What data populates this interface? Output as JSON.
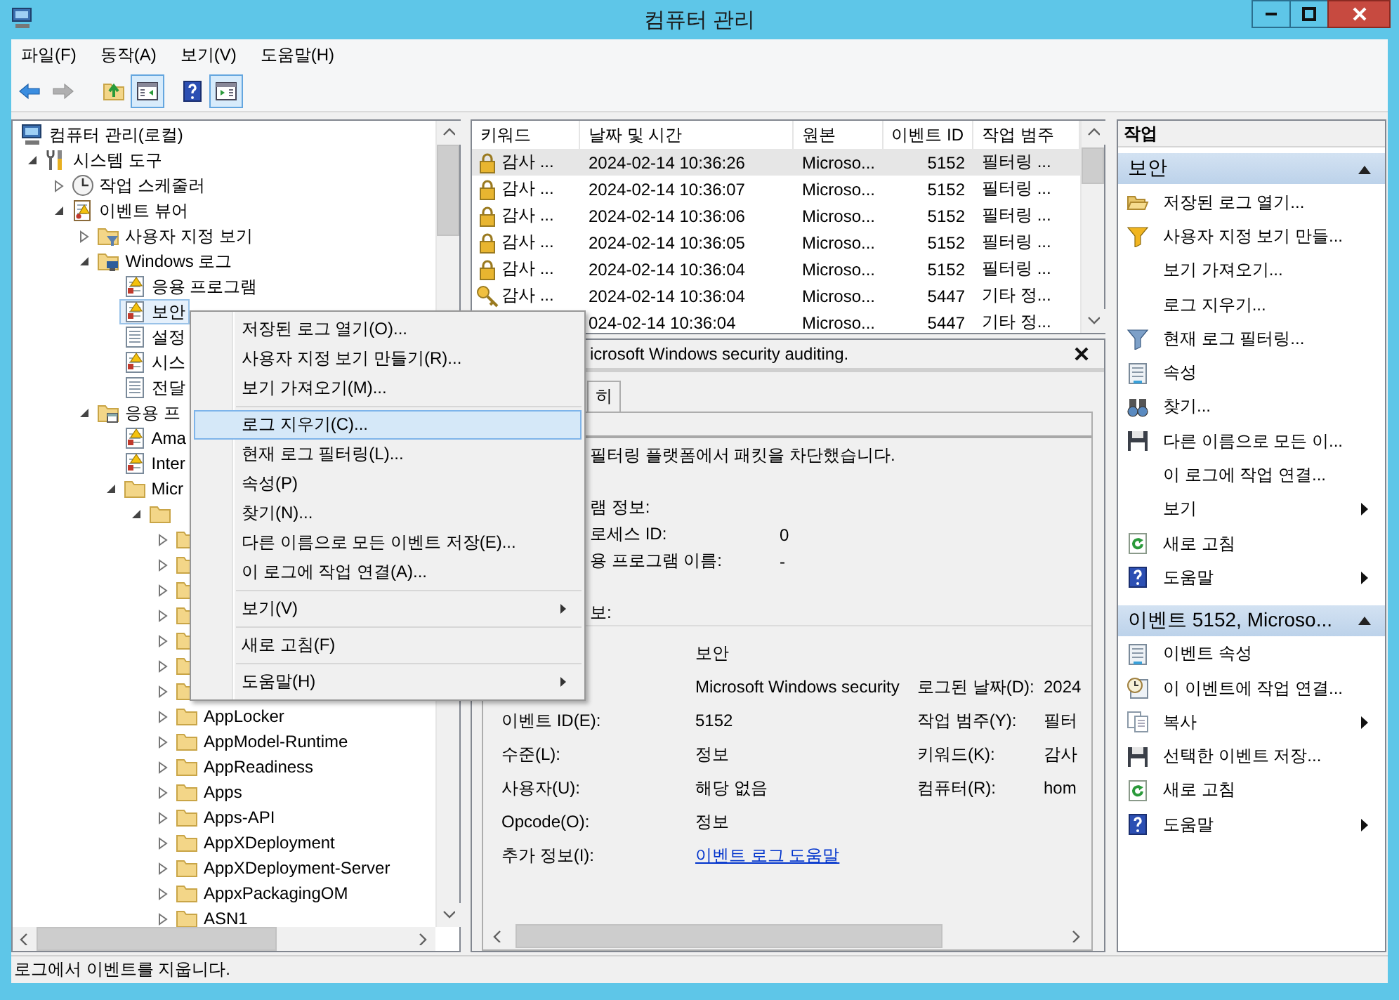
{
  "window": {
    "title": "컴퓨터 관리"
  },
  "menu_bar": [
    {
      "label": "파일(F)"
    },
    {
      "label": "동작(A)"
    },
    {
      "label": "보기(V)"
    },
    {
      "label": "도움말(H)"
    }
  ],
  "toolbar": [
    {
      "kind": "back",
      "pressed": false,
      "disabled": false
    },
    {
      "kind": "forward",
      "pressed": false,
      "disabled": true
    },
    {
      "kind": "up",
      "pressed": false,
      "disabled": false
    },
    {
      "kind": "console-tree",
      "pressed": true,
      "disabled": false
    },
    {
      "kind": "help",
      "pressed": false,
      "disabled": false
    },
    {
      "kind": "action-pane",
      "pressed": true,
      "disabled": false
    }
  ],
  "tree": [
    {
      "label": "컴퓨터 관리(로컬)",
      "kind": "computer",
      "selected": false,
      "children": [
        {
          "label": "시스템 도구",
          "kind": "tools",
          "selected": false,
          "expanded": true,
          "children": [
            {
              "label": "작업 스케줄러",
              "kind": "clock",
              "selected": false,
              "expanded": false
            },
            {
              "label": "이벤트 뷰어",
              "kind": "event-viewer",
              "selected": false,
              "expanded": true,
              "children": [
                {
                  "label": "사용자 지정 보기",
                  "kind": "folder-filter",
                  "selected": false,
                  "expanded": false
                },
                {
                  "label": "Windows 로그",
                  "kind": "folder-computer",
                  "selected": false,
                  "expanded": true,
                  "children": [
                    {
                      "label": "응용 프로그램",
                      "kind": "log-warn",
                      "selected": false
                    },
                    {
                      "label": "보안",
                      "kind": "log-warn",
                      "selected": true
                    },
                    {
                      "label": "설정",
                      "kind": "log",
                      "selected": false
                    },
                    {
                      "label": "시스",
                      "kind": "log-warn",
                      "selected": false
                    },
                    {
                      "label": "전달",
                      "kind": "log",
                      "selected": false
                    }
                  ]
                },
                {
                  "label": "응용 프",
                  "kind": "folder-window",
                  "selected": false,
                  "expanded": true,
                  "children": [
                    {
                      "label": "Ama",
                      "kind": "log-warn",
                      "selected": false
                    },
                    {
                      "label": "Inter",
                      "kind": "log-warn",
                      "selected": false
                    },
                    {
                      "label": "Micr",
                      "kind": "folder",
                      "selected": false,
                      "expanded": true,
                      "children": [
                        {
                          "kind": "folder",
                          "selected": false,
                          "expanded": true,
                          "children": [
                            {
                              "kind": "folder",
                              "selected": false,
                              "expanded": false
                            },
                            {
                              "kind": "folder",
                              "selected": false,
                              "expanded": false
                            },
                            {
                              "kind": "folder",
                              "selected": false,
                              "expanded": false
                            },
                            {
                              "kind": "folder",
                              "selected": false,
                              "expanded": false
                            },
                            {
                              "kind": "folder",
                              "selected": false,
                              "expanded": false
                            },
                            {
                              "kind": "folder",
                              "selected": false,
                              "expanded": false
                            },
                            {
                              "kind": "folder",
                              "selected": false,
                              "expanded": false
                            },
                            {
                              "label": "AppLocker",
                              "kind": "folder",
                              "selected": false,
                              "expanded": false
                            },
                            {
                              "label": "AppModel-Runtime",
                              "kind": "folder",
                              "selected": false,
                              "expanded": false
                            },
                            {
                              "label": "AppReadiness",
                              "kind": "folder",
                              "selected": false,
                              "expanded": false
                            },
                            {
                              "label": "Apps",
                              "kind": "folder",
                              "selected": false,
                              "expanded": false
                            },
                            {
                              "label": "Apps-API",
                              "kind": "folder",
                              "selected": false,
                              "expanded": false
                            },
                            {
                              "label": "AppXDeployment",
                              "kind": "folder",
                              "selected": false,
                              "expanded": false
                            },
                            {
                              "label": "AppXDeployment-Server",
                              "kind": "folder",
                              "selected": false,
                              "expanded": false
                            },
                            {
                              "label": "AppxPackagingOM",
                              "kind": "folder",
                              "selected": false,
                              "expanded": false
                            },
                            {
                              "label": "ASN1",
                              "kind": "folder",
                              "selected": false,
                              "expanded": false
                            }
                          ]
                        }
                      ]
                    }
                  ]
                }
              ]
            }
          ]
        }
      ]
    }
  ],
  "event_table": {
    "columns": [
      "키워드",
      "날짜 및 시간",
      "원본",
      "이벤트 ID",
      "작업 범주"
    ],
    "rows": [
      {
        "kind": "lock",
        "selected": true,
        "keyword": "감사 ...",
        "datetime": "2024-02-14 10:36:26",
        "source": "Microso...",
        "event_id": "5152",
        "category": "필터링 ..."
      },
      {
        "kind": "lock",
        "selected": false,
        "keyword": "감사 ...",
        "datetime": "2024-02-14 10:36:07",
        "source": "Microso...",
        "event_id": "5152",
        "category": "필터링 ..."
      },
      {
        "kind": "lock",
        "selected": false,
        "keyword": "감사 ...",
        "datetime": "2024-02-14 10:36:06",
        "source": "Microso...",
        "event_id": "5152",
        "category": "필터링 ..."
      },
      {
        "kind": "lock",
        "selected": false,
        "keyword": "감사 ...",
        "datetime": "2024-02-14 10:36:05",
        "source": "Microso...",
        "event_id": "5152",
        "category": "필터링 ..."
      },
      {
        "kind": "lock",
        "selected": false,
        "keyword": "감사 ...",
        "datetime": "2024-02-14 10:36:04",
        "source": "Microso...",
        "event_id": "5152",
        "category": "필터링 ..."
      },
      {
        "kind": "key",
        "selected": false,
        "keyword": "감사 ...",
        "datetime": "2024-02-14 10:36:04",
        "source": "Microso...",
        "event_id": "5447",
        "category": "기타 정..."
      },
      {
        "selected": false,
        "datetime": "024-02-14 10:36:04",
        "source": "Microso...",
        "event_id": "5447",
        "category": "기타 정..."
      }
    ]
  },
  "detail": {
    "title": "icrosoft Windows security auditing.",
    "tabs": [
      {
        "label": "히",
        "selected": false
      }
    ],
    "description": [
      [
        {
          "label": "필터링 플랫폼에서 패킷을 차단했습니다."
        }
      ],
      [
        {
          "label": "램 정보:"
        },
        {
          "label": "로세스 ID:",
          "value": "0"
        },
        {
          "label": "용 프로그램 이름:",
          "value": "-"
        }
      ],
      [
        {
          "label": "보:"
        }
      ]
    ],
    "fields": [
      {
        "value": "보안"
      },
      {
        "value": "Microsoft Windows security",
        "label2": "로그된 날짜(D):",
        "value2": "2024"
      },
      {
        "label": "이벤트 ID(E):",
        "value": "5152",
        "label2": "작업 범주(Y):",
        "value2": "필터"
      },
      {
        "label": "수준(L):",
        "value": "정보",
        "label2": "키워드(K):",
        "value2": "감사"
      },
      {
        "label": "사용자(U):",
        "value": "해당 없음",
        "label2": "컴퓨터(R):",
        "value2": "hom"
      },
      {
        "label": "Opcode(O):",
        "value": "정보"
      },
      {
        "label": "추가 정보(I):",
        "link": "이벤트 로그 도움말"
      }
    ]
  },
  "actions": {
    "title": "작업",
    "sections": [
      {
        "title": "보안",
        "expanded": true,
        "items": [
          {
            "label": "저장된 로그 열기...",
            "kind": "open",
            "submenu": false
          },
          {
            "label": "사용자 지정 보기 만들...",
            "kind": "custom-filter",
            "submenu": false
          },
          {
            "label": "보기 가져오기...",
            "kind": "plain",
            "submenu": false
          },
          {
            "label": "로그 지우기...",
            "kind": "plain",
            "submenu": false
          },
          {
            "label": "현재 로그 필터링...",
            "kind": "filter",
            "submenu": false
          },
          {
            "label": "속성",
            "kind": "properties",
            "submenu": false
          },
          {
            "label": "찾기...",
            "kind": "find",
            "submenu": false
          },
          {
            "label": "다른 이름으로 모든 이...",
            "kind": "save",
            "submenu": false
          },
          {
            "label": "이 로그에 작업 연결...",
            "kind": "plain",
            "submenu": false
          },
          {
            "label": "보기",
            "kind": "plain",
            "submenu": true
          },
          {
            "label": "새로 고침",
            "kind": "refresh",
            "submenu": false
          },
          {
            "label": "도움말",
            "kind": "help",
            "submenu": true
          }
        ]
      },
      {
        "title": "이벤트 5152, Microso...",
        "expanded": true,
        "items": [
          {
            "label": "이벤트 속성",
            "kind": "properties",
            "submenu": false
          },
          {
            "label": "이 이벤트에 작업 연결...",
            "kind": "schedule",
            "submenu": false
          },
          {
            "label": "복사",
            "kind": "copy",
            "submenu": true
          },
          {
            "label": "선택한 이벤트 저장...",
            "kind": "save",
            "submenu": false
          },
          {
            "label": "새로 고침",
            "kind": "refresh",
            "submenu": false
          },
          {
            "label": "도움말",
            "kind": "help",
            "submenu": true
          }
        ]
      }
    ]
  },
  "context_menu": {
    "items": [
      {
        "kind": "item",
        "label": "저장된 로그 열기(O)...",
        "selected": false
      },
      {
        "kind": "item",
        "label": "사용자 지정 보기 만들기(R)...",
        "selected": false
      },
      {
        "kind": "item",
        "label": "보기 가져오기(M)...",
        "selected": false
      },
      {
        "kind": "separator"
      },
      {
        "kind": "item",
        "label": "로그 지우기(C)...",
        "selected": true
      },
      {
        "kind": "item",
        "label": "현재 로그 필터링(L)...",
        "selected": false
      },
      {
        "kind": "item",
        "label": "속성(P)",
        "selected": false
      },
      {
        "kind": "item",
        "label": "찾기(N)...",
        "selected": false
      },
      {
        "kind": "item",
        "label": "다른 이름으로 모든 이벤트 저장(E)...",
        "selected": false
      },
      {
        "kind": "item",
        "label": "이 로그에 작업 연결(A)...",
        "selected": false
      },
      {
        "kind": "separator"
      },
      {
        "kind": "submenu",
        "label": "보기(V)",
        "selected": false
      },
      {
        "kind": "separator"
      },
      {
        "kind": "item",
        "label": "새로 고침(F)",
        "selected": false
      },
      {
        "kind": "separator"
      },
      {
        "kind": "submenu",
        "label": "도움말(H)",
        "selected": false
      }
    ]
  },
  "status_bar": {
    "text": "로그에서 이벤트를 지웁니다."
  }
}
